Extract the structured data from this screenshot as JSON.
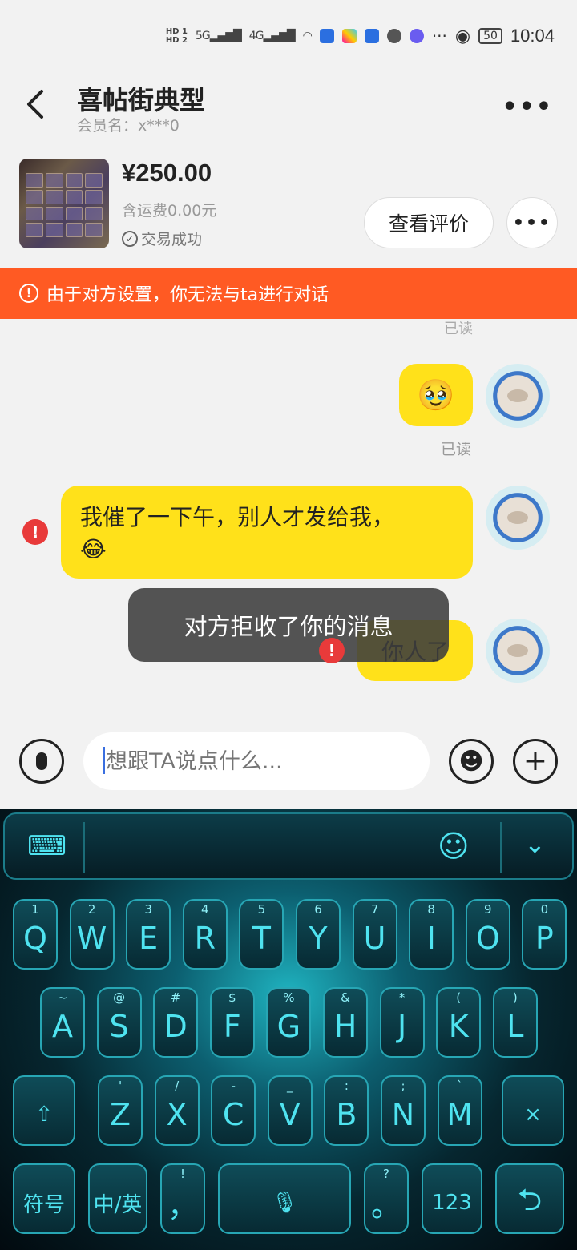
{
  "status_bar": {
    "time": "10:04",
    "battery": "50",
    "hd1": "HD 1",
    "hd2": "HD 2",
    "sig1": "5G",
    "sig2": "4G"
  },
  "header": {
    "title": "喜帖街典型",
    "member": "会员名：x***0",
    "more": "•••"
  },
  "product": {
    "price": "¥250.00",
    "shipping": "含运费0.00元",
    "status": "交易成功",
    "review_btn": "查看评价",
    "more": "•••"
  },
  "warning": {
    "text": "由于对方设置，你无法与ta进行对话"
  },
  "chat": {
    "read_top": "已读",
    "msg1_emoji": "🥹",
    "read_1": "已读",
    "msg2_text": "我催了一下午，别人才发给我，",
    "msg2_emoji": "😂",
    "msg3_text": "你人了",
    "error_mark": "!",
    "toast": "对方拒收了你的消息"
  },
  "input": {
    "placeholder": "想跟TA说点什么...",
    "emoji": "☻",
    "plus": "+"
  },
  "keyboard": {
    "row1": [
      {
        "sub": "1",
        "key": "Q"
      },
      {
        "sub": "2",
        "key": "W"
      },
      {
        "sub": "3",
        "key": "E"
      },
      {
        "sub": "4",
        "key": "R"
      },
      {
        "sub": "5",
        "key": "T"
      },
      {
        "sub": "6",
        "key": "Y"
      },
      {
        "sub": "7",
        "key": "U"
      },
      {
        "sub": "8",
        "key": "I"
      },
      {
        "sub": "9",
        "key": "O"
      },
      {
        "sub": "0",
        "key": "P"
      }
    ],
    "row2": [
      {
        "sub": "~",
        "key": "A"
      },
      {
        "sub": "@",
        "key": "S"
      },
      {
        "sub": "#",
        "key": "D"
      },
      {
        "sub": "$",
        "key": "F"
      },
      {
        "sub": "%",
        "key": "G"
      },
      {
        "sub": "&",
        "key": "H"
      },
      {
        "sub": "*",
        "key": "J"
      },
      {
        "sub": "(",
        "key": "K"
      },
      {
        "sub": ")",
        "key": "L"
      }
    ],
    "row3": [
      {
        "sub": "'",
        "key": "Z"
      },
      {
        "sub": "/",
        "key": "X"
      },
      {
        "sub": "-",
        "key": "C"
      },
      {
        "sub": "_",
        "key": "V"
      },
      {
        "sub": ":",
        "key": "B"
      },
      {
        "sub": ";",
        "key": "N"
      },
      {
        "sub": "`",
        "key": "M"
      }
    ],
    "shift": "⇧",
    "delete": "×",
    "symbols": "符号",
    "lang": "中/英",
    "comma_sub": "!",
    "comma": "，",
    "period_sub": "?",
    "period": "。",
    "numbers": "123",
    "enter": "⮌",
    "space_mic": "🎙"
  }
}
